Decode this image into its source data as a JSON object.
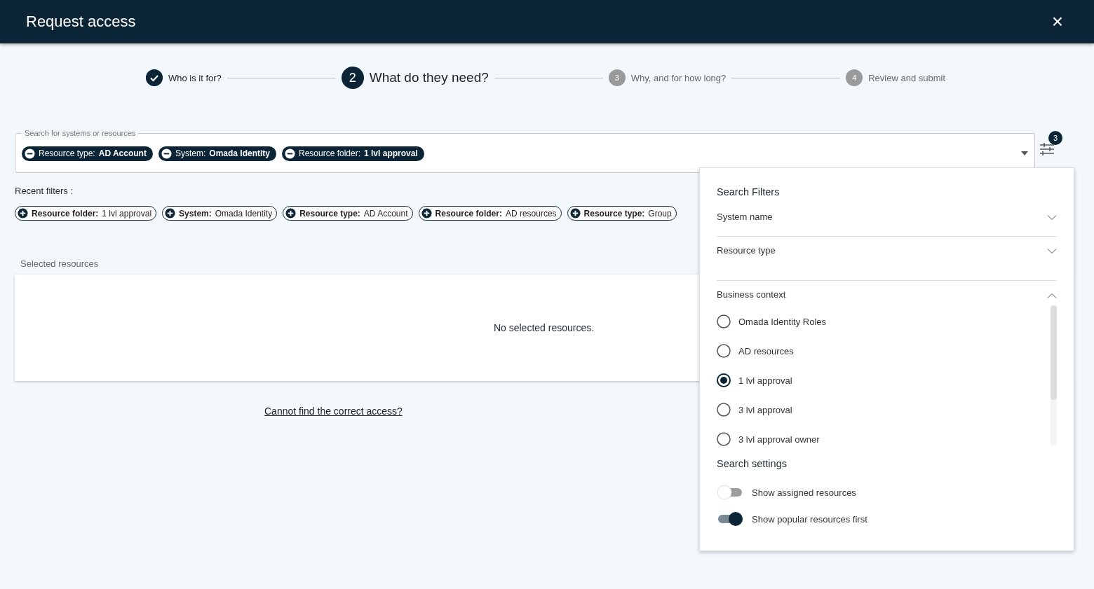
{
  "window": {
    "title": "Request access",
    "close": "×"
  },
  "steps": [
    {
      "label": "Who is it for?",
      "completed": true,
      "selected": false
    },
    {
      "number": "2",
      "label": "What do they need?",
      "completed": false,
      "selected": true
    },
    {
      "number": "3",
      "label": "Why, and for how long?",
      "completed": false,
      "selected": false
    },
    {
      "number": "4",
      "label": "Review and submit",
      "completed": false,
      "selected": false
    }
  ],
  "search": {
    "label": "Search for systems or resources",
    "chips": [
      {
        "label": "Resource type:",
        "value": "AD Account"
      },
      {
        "label": "System:",
        "value": "Omada Identity"
      },
      {
        "label": "Resource folder:",
        "value": "1 lvl approval"
      }
    ],
    "filter_count": "3"
  },
  "recent_filters": {
    "label": "Recent filters :",
    "chips": [
      {
        "label": "Resource folder:",
        "value": "1 lvl approval"
      },
      {
        "label": "System:",
        "value": "Omada Identity"
      },
      {
        "label": "Resource type:",
        "value": "AD Account"
      },
      {
        "label": "Resource folder:",
        "value": "AD resources"
      },
      {
        "label": "Resource type:",
        "value": "Group"
      }
    ]
  },
  "selected_resources": {
    "title": "Selected resources",
    "empty_text": "No selected resources."
  },
  "help_link": "Cannot find the correct access?",
  "filters_panel": {
    "title": "Search Filters",
    "sections": [
      {
        "title": "System name",
        "expanded": false
      },
      {
        "title": "Resource type",
        "expanded": false
      },
      {
        "title": "Business context",
        "expanded": true,
        "options": [
          {
            "label": "Omada Identity Roles",
            "selected": false
          },
          {
            "label": "AD resources",
            "selected": false
          },
          {
            "label": "1 lvl approval",
            "selected": true
          },
          {
            "label": "3 lvl approval",
            "selected": false
          },
          {
            "label": "3 lvl approval owner",
            "selected": false
          }
        ]
      }
    ],
    "settings_title": "Search settings",
    "settings": [
      {
        "label": "Show assigned resources",
        "on": false
      },
      {
        "label": "Show popular resources first",
        "on": true
      }
    ]
  }
}
